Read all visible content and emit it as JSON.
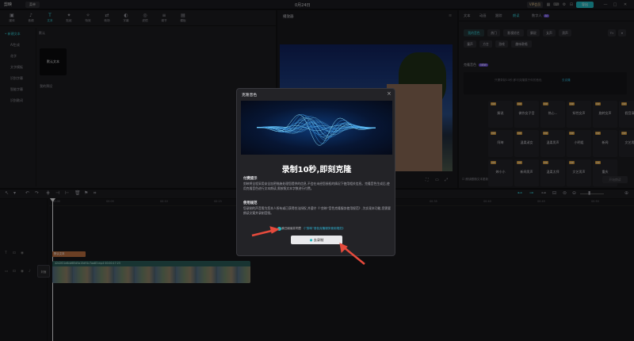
{
  "topbar": {
    "app_name": "剪映",
    "menu_label": "菜单",
    "project_title": "0月24日",
    "vip_label": "VIP会员",
    "export_label": "导出"
  },
  "media": {
    "tabs": [
      {
        "icon": "▣",
        "label": "媒体"
      },
      {
        "icon": "♪",
        "label": "音频"
      },
      {
        "icon": "T",
        "label": "文本"
      },
      {
        "icon": "✦",
        "label": "贴纸"
      },
      {
        "icon": "✧",
        "label": "特效"
      },
      {
        "icon": "⇄",
        "label": "转场"
      },
      {
        "icon": "◐",
        "label": "字幕"
      },
      {
        "icon": "◎",
        "label": "滤镜"
      },
      {
        "icon": "≡",
        "label": "调节"
      },
      {
        "icon": "▤",
        "label": "模板"
      }
    ],
    "active_tab_index": 2,
    "side_items": [
      "• 新建文本",
      "AI生成",
      "花字",
      "文字模板",
      "识别字幕",
      "智能字幕",
      "识别歌词"
    ],
    "category_title": "默认",
    "card_text": "默认文本",
    "card_label": "我的预设"
  },
  "player": {
    "title": "播放器"
  },
  "props": {
    "tabs": [
      "文本",
      "动画",
      "朗读",
      "数字人"
    ],
    "active_tab_index": 2,
    "ai_badge": "AI",
    "chips_row1": [
      "我的音色",
      "热门",
      "影视综艺",
      "解说",
      "女声",
      "男声"
    ],
    "chips_row2": [
      "童声",
      "方言",
      "游戏",
      "趣味歌唱"
    ],
    "clone_title": "克隆音色",
    "clone_badge": "NEW",
    "tip_text": "只需录制10秒,即可克隆属于你的音色",
    "tip_link": "去克隆",
    "voices": [
      "解说",
      "做作女子音",
      "热心...",
      "知性女声",
      "旋转女声",
      "假音演唱",
      "阿绮",
      "温柔淑女",
      "温柔男声",
      "小明姐",
      "新闻",
      "文艺男声",
      "婷小小",
      "新闻男声",
      "温柔太师",
      "文艺男声",
      "重庆"
    ],
    "voice_badge": "VIP",
    "clone_check": "朗读跟随文本更新",
    "clone_button": "开始朗读"
  },
  "timeline": {
    "ruler": [
      "00:00",
      "00:05",
      "00:10",
      "00:15",
      "00:20",
      "00:25",
      "00:30",
      "00:35",
      "00:40",
      "00:45",
      "00:50"
    ],
    "text_clip": "默认文本",
    "video_clip_title": "4242f21e6cbf85d5a15d91c7aa83.mp4  00:00:17:23",
    "cover_label": "封面"
  },
  "dialog": {
    "title": "克隆音色",
    "headline": "录制10秒,即刻克隆",
    "sec1_title": "付费提示",
    "sec1_text": "剪映将全程采用安全加密措施处理您提供的信息,不会在未经您授权的情况下使用相关信息。克隆音色生成后,使用克隆音色进行文本朗读,需按照文本字数进行付费。",
    "sec2_title": "使用规范",
    "sec2_text": "您录制的声音需为您本人所有或已获得合法授权,并遵守《“剪映”音色克隆服务使用规范》,为实现本功能,您需要朗读文案并录制音频。",
    "agree_text": "我已阅读并同意",
    "agree_link": "《“剪映”音色克隆服务使用规范》",
    "button_label": "去录制"
  },
  "colors": {
    "accent": "#1fb7bf",
    "arrow": "#e64a3c",
    "vip": "#d49a3a"
  }
}
